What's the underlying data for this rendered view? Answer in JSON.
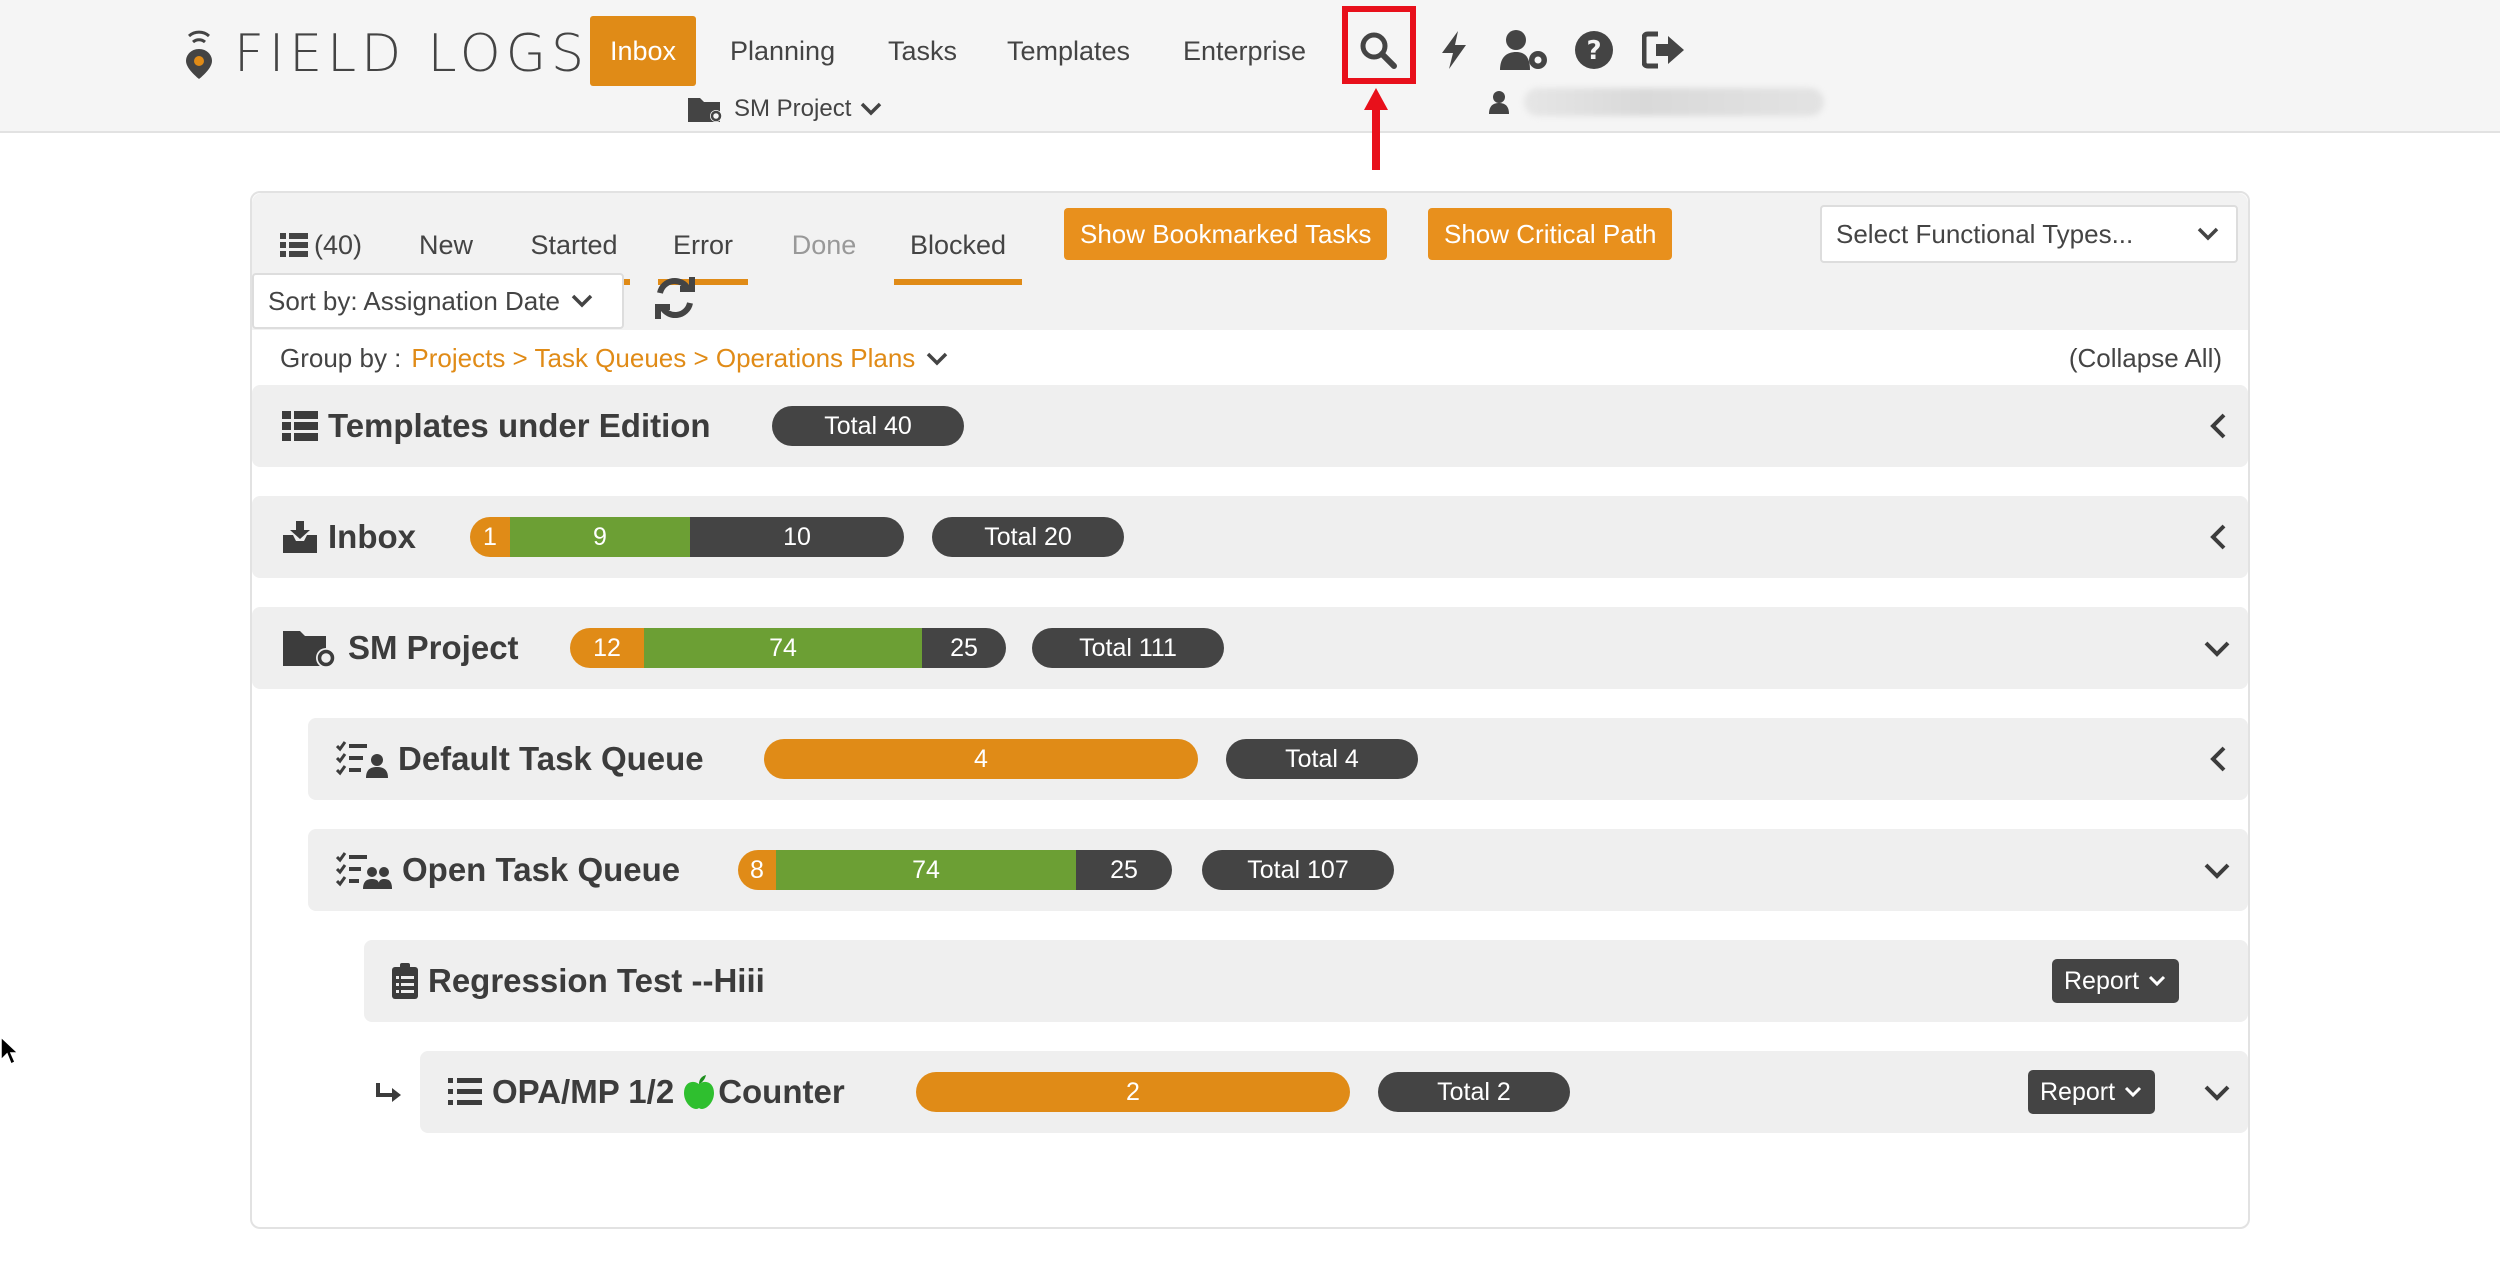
{
  "brand": {
    "name": "FIELD LOGS"
  },
  "nav": {
    "items": [
      {
        "label": "Inbox",
        "active": true
      },
      {
        "label": "Planning"
      },
      {
        "label": "Tasks"
      },
      {
        "label": "Templates"
      },
      {
        "label": "Enterprise"
      }
    ],
    "project_selector": "SM Project",
    "icons": [
      "search-icon",
      "bolt-icon",
      "user-settings-icon",
      "help-icon",
      "logout-icon"
    ],
    "search_highlighted": true
  },
  "filters": {
    "all_count": "(40)",
    "tabs": [
      "New",
      "Started",
      "Error",
      "Done",
      "Blocked"
    ],
    "show_bookmarked": "Show Bookmarked Tasks",
    "show_critical": "Show Critical Path",
    "functional_types_placeholder": "Select Functional Types...",
    "sort_label": "Sort by: Assignation Date",
    "group_by_label": "Group by :",
    "group_by_path": "Projects > Task Queues > Operations Plans",
    "collapse_all": "(Collapse All)"
  },
  "groups": {
    "templates": {
      "title": "Templates under Edition",
      "total": "Total 40"
    },
    "inbox": {
      "title": "Inbox",
      "orange": "1",
      "green": "9",
      "dark": "10",
      "total": "Total 20"
    },
    "sm_project": {
      "title": "SM Project",
      "orange": "12",
      "green": "74",
      "dark": "25",
      "total": "Total 111"
    },
    "default_queue": {
      "title": "Default Task Queue",
      "orange": "4",
      "total": "Total 4"
    },
    "open_queue": {
      "title": "Open Task Queue",
      "orange": "8",
      "green": "74",
      "dark": "25",
      "total": "Total 107"
    },
    "regression": {
      "title": "Regression Test --Hiii",
      "report": "Report"
    },
    "opa": {
      "title_prefix": "OPA/MP 1/2",
      "title_suffix": "Counter",
      "orange": "2",
      "total": "Total 2",
      "report": "Report"
    }
  },
  "colors": {
    "accent": "#e08b17",
    "green": "#6c9f34",
    "dark": "#444444",
    "highlight": "#e8101b"
  }
}
